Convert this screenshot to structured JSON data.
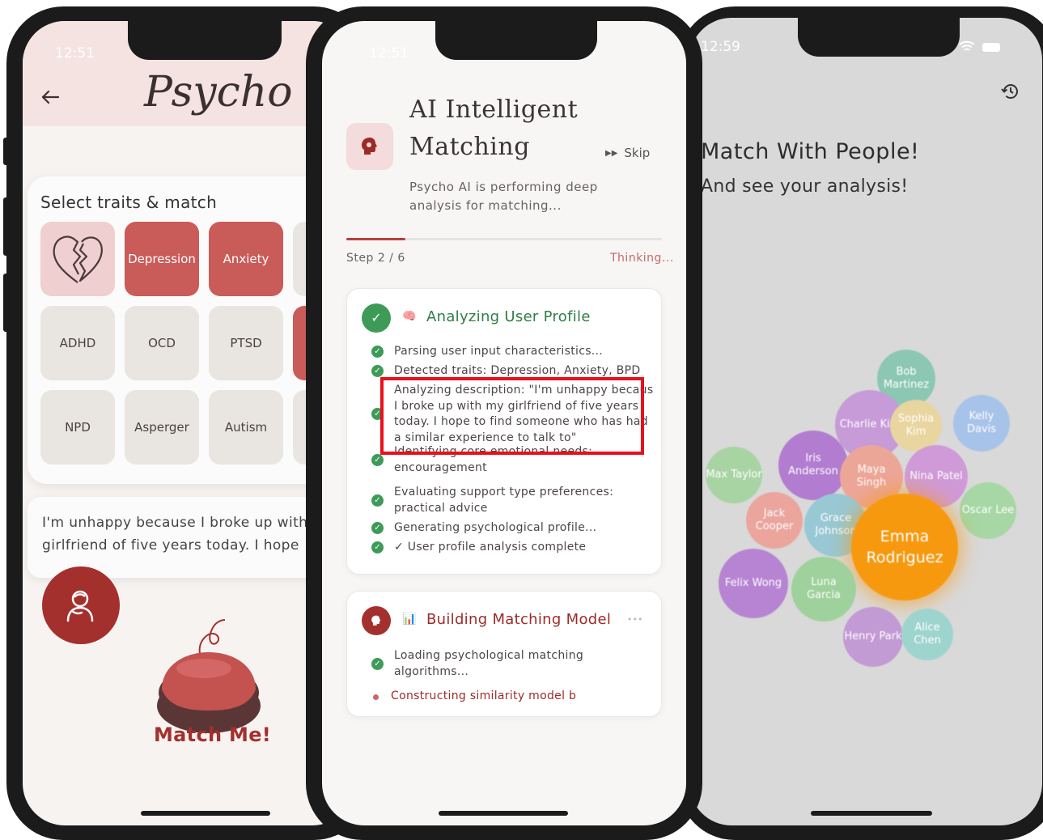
{
  "phone1": {
    "time": "12:51",
    "logo": "Psycho",
    "back_icon": "back-arrow-icon",
    "traits_title": "Select traits & match",
    "traits": [
      {
        "label": "",
        "icon": "broken-heart-icon",
        "state": "pink"
      },
      {
        "label": "Depression",
        "state": "selected"
      },
      {
        "label": "Anxiety",
        "state": "selected"
      },
      {
        "label": "ADHD",
        "state": "default"
      },
      {
        "label": "OCD",
        "state": "default"
      },
      {
        "label": "PTSD",
        "state": "default"
      },
      {
        "label": "NPD",
        "state": "default"
      },
      {
        "label": "Asperger",
        "state": "default"
      },
      {
        "label": "Autism",
        "state": "default"
      }
    ],
    "description_line1": "I'm unhappy because I broke up with",
    "description_line2": "girlfriend of five years today. I hope",
    "avatar_icon": "person-hug-icon",
    "match_label": "Match Me!",
    "accent": "#c95b58"
  },
  "phone2": {
    "time": "12:51",
    "title_line1": "AI Intelligent",
    "title_line2": "Matching",
    "brain_icon": "brain-gear-icon",
    "skip_label": "Skip",
    "skip_icon": "fast-forward-icon",
    "subtitle_line1": "Psycho AI is performing deep",
    "subtitle_line2": "analysis for matching...",
    "progress": 0.1875,
    "step_text": "Step 2 / 6",
    "status_text": "Thinking...",
    "card1": {
      "title": "Analyzing User Profile",
      "emoji": "🧠",
      "items": [
        {
          "lines": [
            "Parsing user input characteristics..."
          ]
        },
        {
          "lines": [
            "Detected traits: Depression, Anxiety, BPD"
          ]
        },
        {
          "lines": [
            "Analyzing description: \"I'm unhappy becaus",
            "I broke up with my girlfriend of five years",
            "today. I hope to find someone who has had",
            "a similar experience to talk to\""
          ]
        },
        {
          "lines": [
            "Identifying core emotional needs:",
            "encouragement"
          ]
        },
        {
          "lines": [
            "Evaluating support type preferences:",
            "practical advice"
          ]
        },
        {
          "lines": [
            "Generating psychological profile..."
          ]
        },
        {
          "lines": [
            "✓ User profile analysis complete"
          ]
        }
      ]
    },
    "card2": {
      "title": "Building Matching Model",
      "emoji": "📊",
      "more": "•••",
      "items": [
        {
          "lines": [
            "Loading psychological matching",
            "algorithms..."
          ],
          "state": "done"
        },
        {
          "lines": [
            "Constructing similarity model b"
          ],
          "state": "active"
        }
      ]
    },
    "highlight_color": "#e8101c",
    "success_color": "#3e9b57"
  },
  "phone3": {
    "time": "12:59",
    "history_icon": "history-icon",
    "headline": "Match With People!",
    "subline": "And see your analysis!",
    "people": [
      {
        "name": "Bob Martinez",
        "l1": "Bob",
        "l2": "Martinez",
        "color": "#8cc7b4"
      },
      {
        "name": "Charlie Kim",
        "l1": "Charlie Kim",
        "l2": "",
        "color": "#c79ad8"
      },
      {
        "name": "Sophia Kim",
        "l1": "Sophia Kim",
        "l2": "",
        "color": "#e9d5a0"
      },
      {
        "name": "Kelly Davis",
        "l1": "Kelly Davis",
        "l2": "",
        "color": "#a8c3ea"
      },
      {
        "name": "Max Taylor",
        "l1": "Max Taylor",
        "l2": "",
        "color": "#a8d4a4"
      },
      {
        "name": "Iris Anderson",
        "l1": "Iris",
        "l2": "Anderson",
        "color": "#b27cd0"
      },
      {
        "name": "Maya Singh",
        "l1": "Maya",
        "l2": "Singh",
        "color": "#eca698"
      },
      {
        "name": "Nina Patel",
        "l1": "Nina Patel",
        "l2": "",
        "color": "#d09ad8"
      },
      {
        "name": "Oscar Lee",
        "l1": "Oscar Lee",
        "l2": "",
        "color": "#a6d7a4"
      },
      {
        "name": "Jack Cooper",
        "l1": "Jack",
        "l2": "Cooper",
        "color": "#eba59d"
      },
      {
        "name": "Grace Johnson",
        "l1": "Grace",
        "l2": "Johnson",
        "color": "#98c8d4"
      },
      {
        "name": "Emma Rodriguez",
        "l1": "Emma",
        "l2": "Rodriguez",
        "color": "#f7990f"
      },
      {
        "name": "Felix Wong",
        "l1": "Felix Wong",
        "l2": "",
        "color": "#b784d3"
      },
      {
        "name": "Luna Garcia",
        "l1": "Luna",
        "l2": "Garcia",
        "color": "#9fd19c"
      },
      {
        "name": "Henry Park",
        "l1": "Henry Park",
        "l2": "",
        "color": "#c29ad4"
      },
      {
        "name": "Alice Chen",
        "l1": "Alice Chen",
        "l2": "",
        "color": "#9ed4ce"
      }
    ]
  }
}
